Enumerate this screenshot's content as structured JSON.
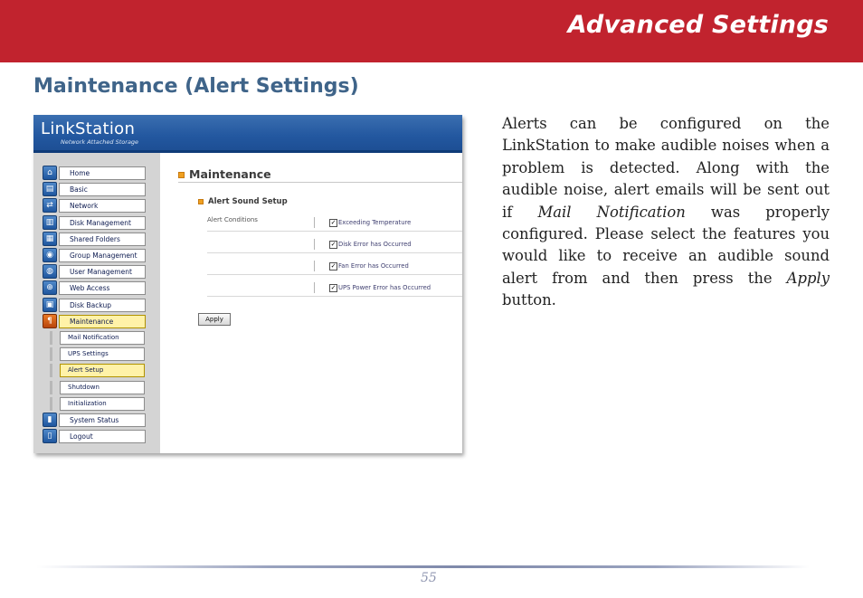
{
  "header": {
    "section_title": "Advanced Settings"
  },
  "page": {
    "heading": "Maintenance (Alert Settings)"
  },
  "screenshot": {
    "brand": "LinkStation",
    "brand_tagline": "Network Attached Storage",
    "nav_items": [
      {
        "label": "Home",
        "icon": "home-icon",
        "glyph": "⌂"
      },
      {
        "label": "Basic",
        "icon": "basic-icon",
        "glyph": "▤"
      },
      {
        "label": "Network",
        "icon": "network-icon",
        "glyph": "⇄"
      },
      {
        "label": "Disk Management",
        "icon": "disk-management-icon",
        "glyph": "▥"
      },
      {
        "label": "Shared Folders",
        "icon": "shared-folders-icon",
        "glyph": "▦"
      },
      {
        "label": "Group Management",
        "icon": "group-icon",
        "glyph": "◉"
      },
      {
        "label": "User Management",
        "icon": "user-icon",
        "glyph": "◍"
      },
      {
        "label": "Web Access",
        "icon": "web-access-icon",
        "glyph": "⊕"
      },
      {
        "label": "Disk Backup",
        "icon": "disk-backup-icon",
        "glyph": "▣"
      },
      {
        "label": "Maintenance",
        "icon": "maintenance-icon",
        "glyph": "¶"
      }
    ],
    "sub_items": [
      {
        "label": "Mail Notification"
      },
      {
        "label": "UPS Settings"
      },
      {
        "label": "Alert Setup"
      },
      {
        "label": "Shutdown"
      },
      {
        "label": "Initialization"
      }
    ],
    "bottom_items": [
      {
        "label": "System Status",
        "icon": "system-status-icon",
        "glyph": "▮"
      },
      {
        "label": "Logout",
        "icon": "logout-icon",
        "glyph": "▯"
      }
    ],
    "active_item": "Maintenance",
    "active_sub_item": "Alert Setup",
    "main_title": "Maintenance",
    "sub_title": "Alert Sound Setup",
    "conditions_label": "Alert Conditions",
    "conditions": [
      {
        "label": "Exceeding Temperature",
        "checked": true
      },
      {
        "label": "Disk Error has Occurred",
        "checked": true
      },
      {
        "label": "Fan Error has Occurred",
        "checked": true
      },
      {
        "label": "UPS Power Error has Occurred",
        "checked": true
      }
    ],
    "apply_label": "Apply",
    "check_glyph": "✓"
  },
  "body": {
    "part1": "Alerts can be configured on the LinkStation to make audible noises when a problem is detected.  Along with the audible noise, alert emails will be sent out if ",
    "mail_notification": "Mail Notification",
    "part2": " was properly configured.  Please select the features you would like to receive an audible sound alert from and then press the ",
    "apply": "Apply",
    "part3": " button."
  },
  "footer": {
    "page_number": "55"
  },
  "colors": {
    "band": "#c1232e",
    "heading": "#3f6489",
    "highlight": "#fff2a8"
  }
}
